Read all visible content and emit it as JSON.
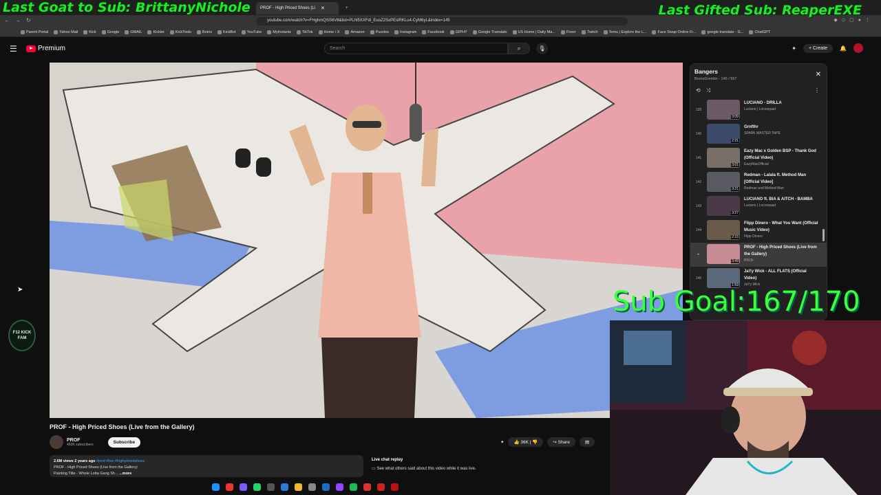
{
  "overlay": {
    "last_goat": "Last Goat to Sub: BrittanyNichole",
    "last_gifted": "Last Gifted Sub: ReaperEXE",
    "sub_goal": "Sub Goal:167/170"
  },
  "browser": {
    "active_tab_title": "PROF - High Priced Shoes (Li",
    "url": "youtube.com/watch?v=FHghmQSS6V8&list=PLhl5XXFdl_EuoZ2SxPEslRKLu4-CyM6yL&index=145",
    "bookmarks": [
      "Parent Portal",
      "Yahoo Mail",
      "Kick",
      "Google",
      "GMAIL",
      "Kicklet",
      "KickTools",
      "Botrix",
      "KickBot",
      "YouTube",
      "MyInstants",
      "TikTok",
      "Home / X",
      "Amazon",
      "Puzzles",
      "Instagram",
      "Facebook",
      "GIPHY",
      "Google Translate",
      "US Home | Daily Ma...",
      "Fiverr",
      "Twitch",
      "Temu | Explore the L...",
      "Face Swap Online Fr...",
      "google translate - G...",
      "ChatGPT"
    ]
  },
  "youtube": {
    "logo_label": "Premium",
    "search_placeholder": "Search",
    "create_label": "Create"
  },
  "video": {
    "title": "PROF - High Priced Shoes (Live from the Gallery)",
    "channel": "PROF",
    "subscribers": "493K subscribers",
    "subscribe_label": "Subscribe",
    "likes": "36K",
    "share_label": "Share",
    "stats": "2.6M views  2 years ago",
    "hashtags": "#prof #live #highpricedshoes",
    "desc_line1": "PROF - High Priced Shoes (Live from the Gallery)",
    "desc_line2": "Painting Title - Whole Lotta Gang Sh...",
    "more_label": "...more",
    "live_chat_title": "Live chat replay",
    "live_chat_text": "See what others said about this video while it was live."
  },
  "badge": {
    "text": "F12 KICK FAM"
  },
  "playlist": {
    "title": "Bangers",
    "subtitle": "BronxGremlin - 145 / 557",
    "items": [
      {
        "index": "139",
        "title": "LUCIANO - DRILLA",
        "channel": "Luciano | Locosquad",
        "duration": "3:09",
        "active": false
      },
      {
        "index": "140",
        "title": "Grnfthr",
        "channel": "SPARK MASTER TAPE",
        "duration": "2:21",
        "active": false
      },
      {
        "index": "141",
        "title": "Eazy Mac x Golden BSP - Thank God (Official Video)",
        "channel": "EazyMacOfficial",
        "duration": "3:01",
        "active": false
      },
      {
        "index": "142",
        "title": "Redman - Lalala ft. Method Man [Official Video]",
        "channel": "Redman and Method Man",
        "duration": "3:21",
        "active": false
      },
      {
        "index": "143",
        "title": "LUCIANO ft. BIA & AITCH - BAMBA",
        "channel": "Luciano | Locosquad",
        "duration": "3:27",
        "active": false
      },
      {
        "index": "144",
        "title": "Flipp Dinero - What You Want (Official Music Video)",
        "channel": "Flipp Dinero",
        "duration": "2:15",
        "active": false
      },
      {
        "index": "▸",
        "title": "PROF - High Priced Shoes (Live from the Gallery)",
        "channel": "PROF",
        "duration": "3:49",
        "active": true
      },
      {
        "index": "146",
        "title": "JaYy Wick - ALL FLATS (Official Video)",
        "channel": "JaYy Wick",
        "duration": "1:59",
        "active": false
      }
    ]
  }
}
